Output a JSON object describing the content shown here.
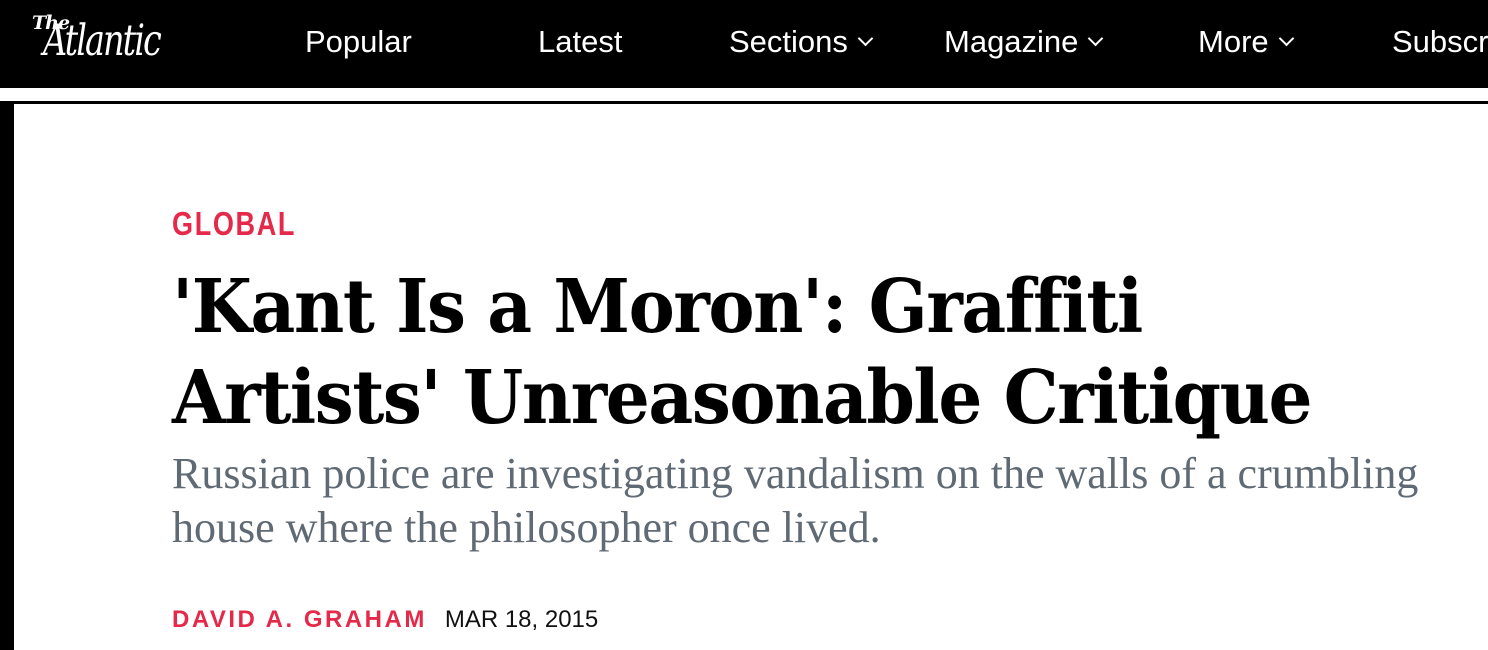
{
  "header": {
    "logo": {
      "small": "The",
      "main": "Atlantic"
    },
    "nav": [
      {
        "label": "Popular",
        "has_dropdown": false
      },
      {
        "label": "Latest",
        "has_dropdown": false
      },
      {
        "label": "Sections",
        "has_dropdown": true
      },
      {
        "label": "Magazine",
        "has_dropdown": true
      },
      {
        "label": "More",
        "has_dropdown": true
      },
      {
        "label": "Subscr",
        "has_dropdown": false
      }
    ]
  },
  "article": {
    "section": "GLOBAL",
    "headline": "'Kant Is a Moron': Graffiti Artists' Unreasonable Critique",
    "dek": "Russian police are investigating vandalism on the walls of a crumbling house where the philosopher once lived.",
    "author": "DAVID A. GRAHAM",
    "date": "MAR 18, 2015"
  },
  "colors": {
    "nav_background": "#000000",
    "nav_text": "#ffffff",
    "accent": "#e5294a",
    "dek_text": "#5f6a74",
    "headline_text": "#000000"
  }
}
